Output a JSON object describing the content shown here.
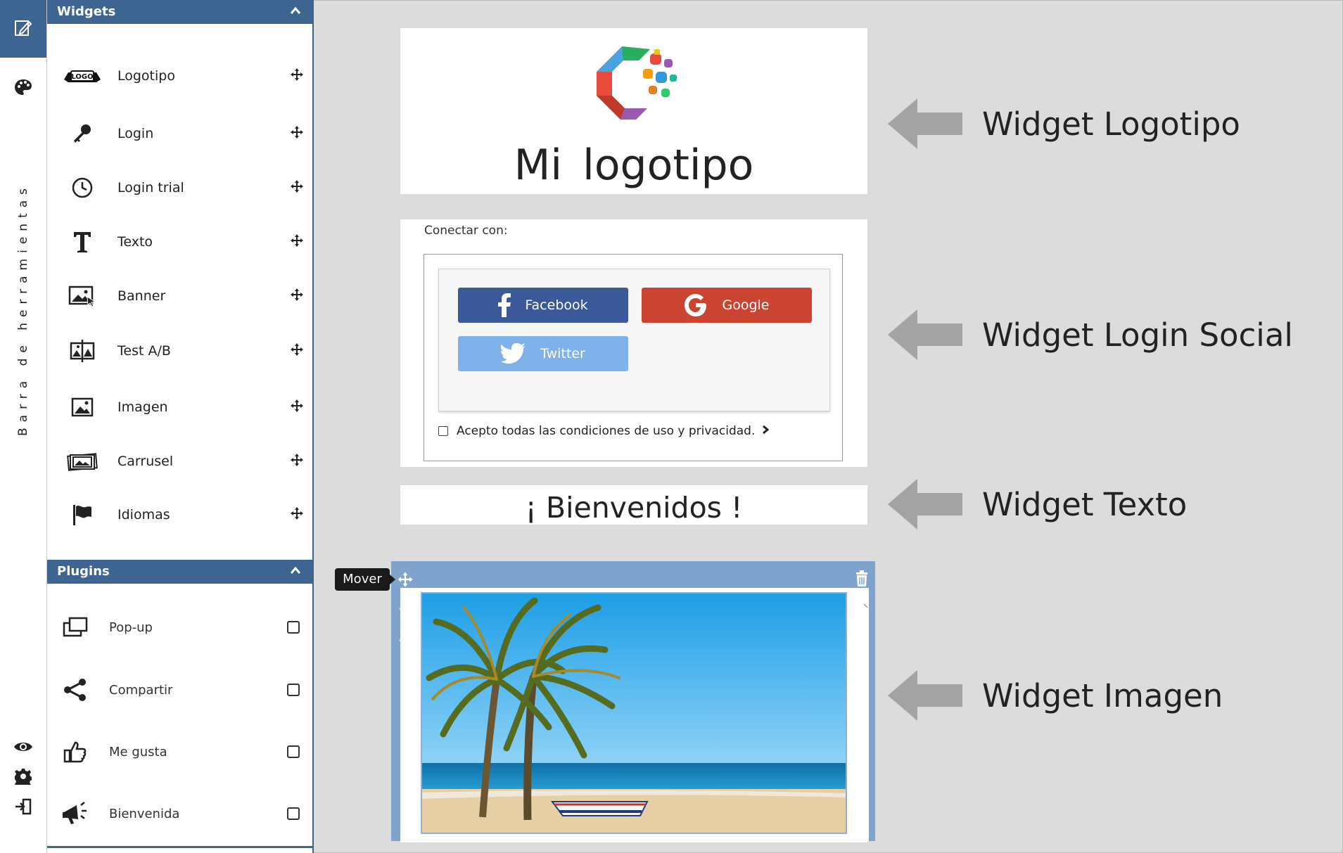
{
  "sidebar": {
    "vertical_label": "Barra de herramientas",
    "top_icons": [
      "edit-icon",
      "palette-icon"
    ],
    "bottom_icons": [
      "eye-icon",
      "gear-icon",
      "logout-icon"
    ]
  },
  "widgets_panel": {
    "title": "Widgets",
    "items": [
      {
        "label": "Logotipo",
        "icon": "logo-icon"
      },
      {
        "label": "Login",
        "icon": "key-icon"
      },
      {
        "label": "Login trial",
        "icon": "clock-icon"
      },
      {
        "label": "Texto",
        "icon": "text-icon"
      },
      {
        "label": "Banner",
        "icon": "banner-icon"
      },
      {
        "label": "Test A/B",
        "icon": "ab-test-icon"
      },
      {
        "label": "Imagen",
        "icon": "image-icon"
      },
      {
        "label": "Carrusel",
        "icon": "carousel-icon"
      },
      {
        "label": "Idiomas",
        "icon": "flag-icon"
      }
    ]
  },
  "plugins_panel": {
    "title": "Plugins",
    "items": [
      {
        "label": "Pop-up",
        "icon": "popup-icon"
      },
      {
        "label": "Compartir",
        "icon": "share-icon"
      },
      {
        "label": "Me gusta",
        "icon": "thumbs-up-icon"
      },
      {
        "label": "Bienvenida",
        "icon": "megaphone-icon"
      }
    ]
  },
  "canvas": {
    "logo_widget": {
      "text": "Mi  logotipo"
    },
    "login_social": {
      "connect_label": "Conectar con:",
      "buttons": {
        "facebook": "Facebook",
        "google": "Google",
        "twitter": "Twitter"
      },
      "terms": "Acepto todas las condiciones de uso y privacidad."
    },
    "text_widget": {
      "text": "¡ Bienvenidos !"
    },
    "image_widget": {
      "tooltip": "Mover"
    }
  },
  "annotations": [
    "Widget Logotipo",
    "Widget Login Social",
    "Widget Texto",
    "Widget Imagen"
  ],
  "colors": {
    "accent": "#3e6591",
    "facebook": "#3b5998",
    "google": "#cb4331",
    "twitter": "#7fb1ea"
  }
}
